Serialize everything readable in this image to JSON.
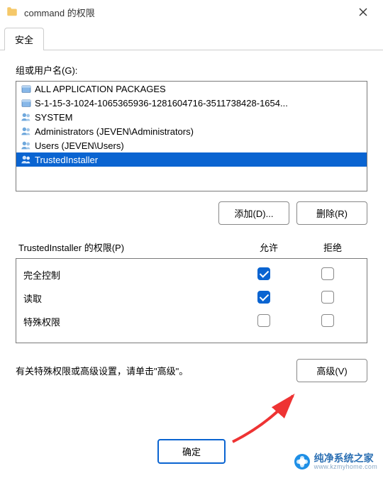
{
  "title": "command 的权限",
  "tabs": {
    "security": "安全"
  },
  "groups_label": "组或用户名(G):",
  "users": [
    {
      "icon": "package",
      "name": "ALL APPLICATION PACKAGES"
    },
    {
      "icon": "package",
      "name": "S-1-15-3-1024-1065365936-1281604716-3511738428-1654..."
    },
    {
      "icon": "group",
      "name": "SYSTEM"
    },
    {
      "icon": "group",
      "name": "Administrators (JEVEN\\Administrators)"
    },
    {
      "icon": "group",
      "name": "Users (JEVEN\\Users)"
    },
    {
      "icon": "group",
      "name": "TrustedInstaller",
      "selected": true
    }
  ],
  "buttons": {
    "add": "添加(D)...",
    "remove": "删除(R)",
    "advanced": "高级(V)",
    "ok": "确定"
  },
  "perm_title": "TrustedInstaller 的权限(P)",
  "col_allow": "允许",
  "col_deny": "拒绝",
  "permissions": [
    {
      "name": "完全控制",
      "allow": true,
      "deny": false
    },
    {
      "name": "读取",
      "allow": true,
      "deny": false
    },
    {
      "name": "特殊权限",
      "allow": false,
      "deny": false
    }
  ],
  "adv_hint": "有关特殊权限或高级设置，请单击\"高级\"。",
  "watermark": {
    "main": "纯净系统之家",
    "sub": "www.kzmyhome.com"
  }
}
